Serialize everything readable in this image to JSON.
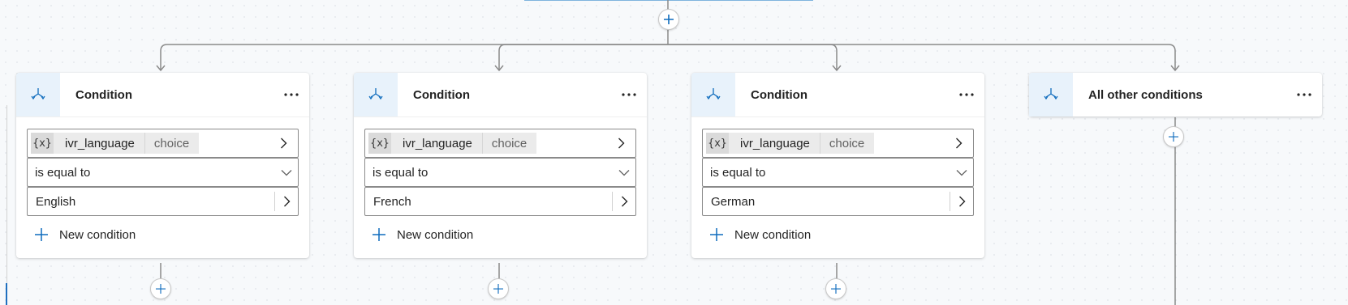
{
  "branches": [
    {
      "title": "Condition",
      "variable": {
        "icon": "{x}",
        "name": "ivr_language",
        "type": "choice"
      },
      "operator": "is equal to",
      "value": "English",
      "new_condition_label": "New condition"
    },
    {
      "title": "Condition",
      "variable": {
        "icon": "{x}",
        "name": "ivr_language",
        "type": "choice"
      },
      "operator": "is equal to",
      "value": "French",
      "new_condition_label": "New condition"
    },
    {
      "title": "Condition",
      "variable": {
        "icon": "{x}",
        "name": "ivr_language",
        "type": "choice"
      },
      "operator": "is equal to",
      "value": "German",
      "new_condition_label": "New condition"
    },
    {
      "title": "All other conditions"
    }
  ],
  "colors": {
    "accent": "#0f6cbd",
    "connector": "#8a8a8a",
    "icon_bg": "#e8f2fb"
  },
  "icons": {
    "branch": "branch-icon",
    "more": "more-options-icon",
    "add": "add-node-icon",
    "chevron_right": "chevron-right-icon",
    "chevron_down": "chevron-down-icon"
  }
}
